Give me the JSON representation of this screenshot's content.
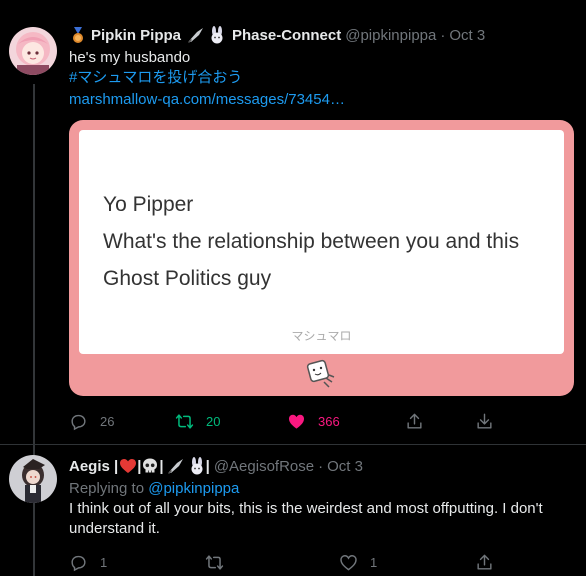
{
  "tweet1": {
    "display_name": "Pipkin Pippa",
    "name_suffix": "Phase-Connect",
    "handle": "@pipkinpippa",
    "separator": "·",
    "date": "Oct 3",
    "text": "he's my husbando",
    "hashtag": "#マシュマロを投げ合おう",
    "link": "marshmallow-qa.com/messages/73454…",
    "card": {
      "lines": [
        "Yo Pipper",
        "What's the relationship between you and this",
        "Ghost Politics guy"
      ],
      "footer": "マシュマロ"
    },
    "replies": "26",
    "retweets": "20",
    "likes": "366"
  },
  "tweet2": {
    "display_name_prefix": "Aegis |",
    "display_name_sep": "|",
    "handle": "@AegisofRose",
    "separator": "·",
    "date": "Oct 3",
    "replying_prefix": "Replying to",
    "replying_to": "@pipkinpippa",
    "text": "I think out of all your bits, this is the weirdest and most offputting. I don't understand it.",
    "replies": "1",
    "likes": "1"
  },
  "colors": {
    "accent": "#1d9bf0",
    "retweet": "#00ba7c",
    "like": "#f91880",
    "card": "#f19a9c"
  },
  "icons": [
    "reply-icon",
    "retweet-icon",
    "like-icon",
    "share-icon",
    "medal-icon",
    "knife-icon",
    "rabbit-icon",
    "heart-icon",
    "skull-icon"
  ]
}
